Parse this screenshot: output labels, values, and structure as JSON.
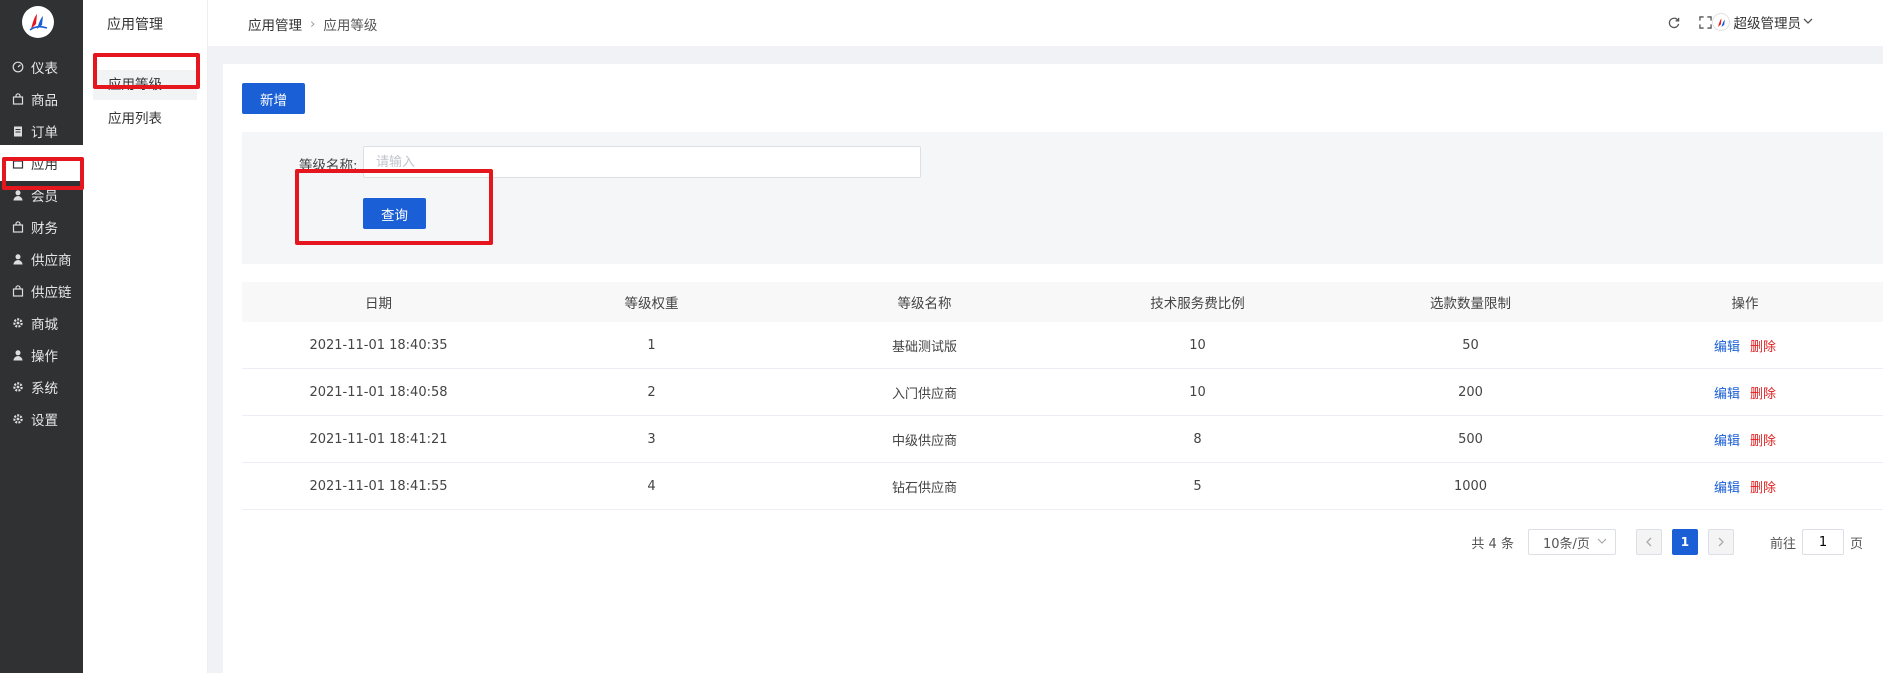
{
  "sidebar": {
    "items": [
      {
        "label": "仪表",
        "icon": "gauge-icon"
      },
      {
        "label": "商品",
        "icon": "bag-icon"
      },
      {
        "label": "订单",
        "icon": "clipboard-icon"
      },
      {
        "label": "应用",
        "icon": "bag-icon"
      },
      {
        "label": "会员",
        "icon": "user-icon"
      },
      {
        "label": "财务",
        "icon": "bag-icon"
      },
      {
        "label": "供应商",
        "icon": "user-icon"
      },
      {
        "label": "供应链",
        "icon": "bag-icon"
      },
      {
        "label": "商城",
        "icon": "gear-icon"
      },
      {
        "label": "操作",
        "icon": "user-icon"
      },
      {
        "label": "系统",
        "icon": "gear-icon"
      },
      {
        "label": "设置",
        "icon": "gear-icon"
      }
    ],
    "active": "应用"
  },
  "submenu": {
    "title": "应用管理",
    "items": [
      {
        "label": "应用等级"
      },
      {
        "label": "应用列表"
      }
    ]
  },
  "header": {
    "breadcrumb": [
      "应用管理",
      "应用等级"
    ],
    "user_name": "超级管理员"
  },
  "toolbar": {
    "add_label": "新增"
  },
  "search": {
    "label": "等级名称:",
    "placeholder": "请输入",
    "value": "",
    "query_label": "查询"
  },
  "table": {
    "columns": [
      "日期",
      "等级权重",
      "等级名称",
      "技术服务费比例",
      "选款数量限制",
      "操作"
    ],
    "rows": [
      {
        "date": "2021-11-01 18:40:35",
        "weight": "1",
        "name": "基础测试版",
        "fee": "10",
        "limit": "50"
      },
      {
        "date": "2021-11-01 18:40:58",
        "weight": "2",
        "name": "入门供应商",
        "fee": "10",
        "limit": "200"
      },
      {
        "date": "2021-11-01 18:41:21",
        "weight": "3",
        "name": "中级供应商",
        "fee": "8",
        "limit": "500"
      },
      {
        "date": "2021-11-01 18:41:55",
        "weight": "4",
        "name": "钻石供应商",
        "fee": "5",
        "limit": "1000"
      }
    ],
    "edit_label": "编辑",
    "delete_label": "删除"
  },
  "pagination": {
    "total": "共 4 条",
    "page_size": "10条/页",
    "current": "1",
    "goto_prefix": "前往",
    "goto_value": "1",
    "goto_suffix": "页"
  },
  "colors": {
    "sidebar_bg": "#2f3133",
    "primary": "#1a5fd6",
    "danger": "#e02020",
    "highlight": "#e5161d"
  }
}
